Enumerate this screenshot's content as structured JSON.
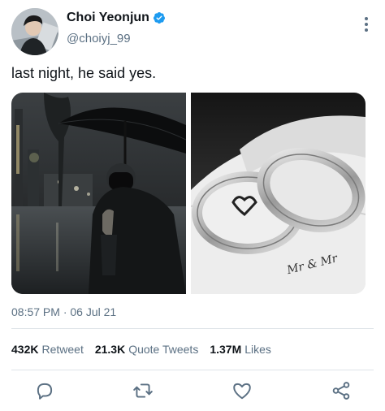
{
  "tweet": {
    "author": {
      "display_name": "Choi Yeonjun",
      "handle": "@choiyj_99",
      "verified": true,
      "avatar": "profile-photo"
    },
    "text": "last night, he said yes.",
    "media": [
      {
        "icon": "photo-person-with-umbrella"
      },
      {
        "icon": "photo-wedding-rings",
        "engraving": "Mr & Mr"
      }
    ],
    "timestamp": "08:57 PM · 06 Jul 21",
    "stats": {
      "retweets": {
        "value": "432K",
        "label": "Retweet"
      },
      "quote_tweets": {
        "value": "21.3K",
        "label": "Quote Tweets"
      },
      "likes": {
        "value": "1.37M",
        "label": "Likes"
      }
    },
    "actions": [
      "reply-icon",
      "retweet-icon",
      "like-icon",
      "share-icon"
    ]
  },
  "colors": {
    "text": "#0f1419",
    "secondary": "#5b7083",
    "verified": "#1d9bf0",
    "divider": "#dfe4e8"
  }
}
